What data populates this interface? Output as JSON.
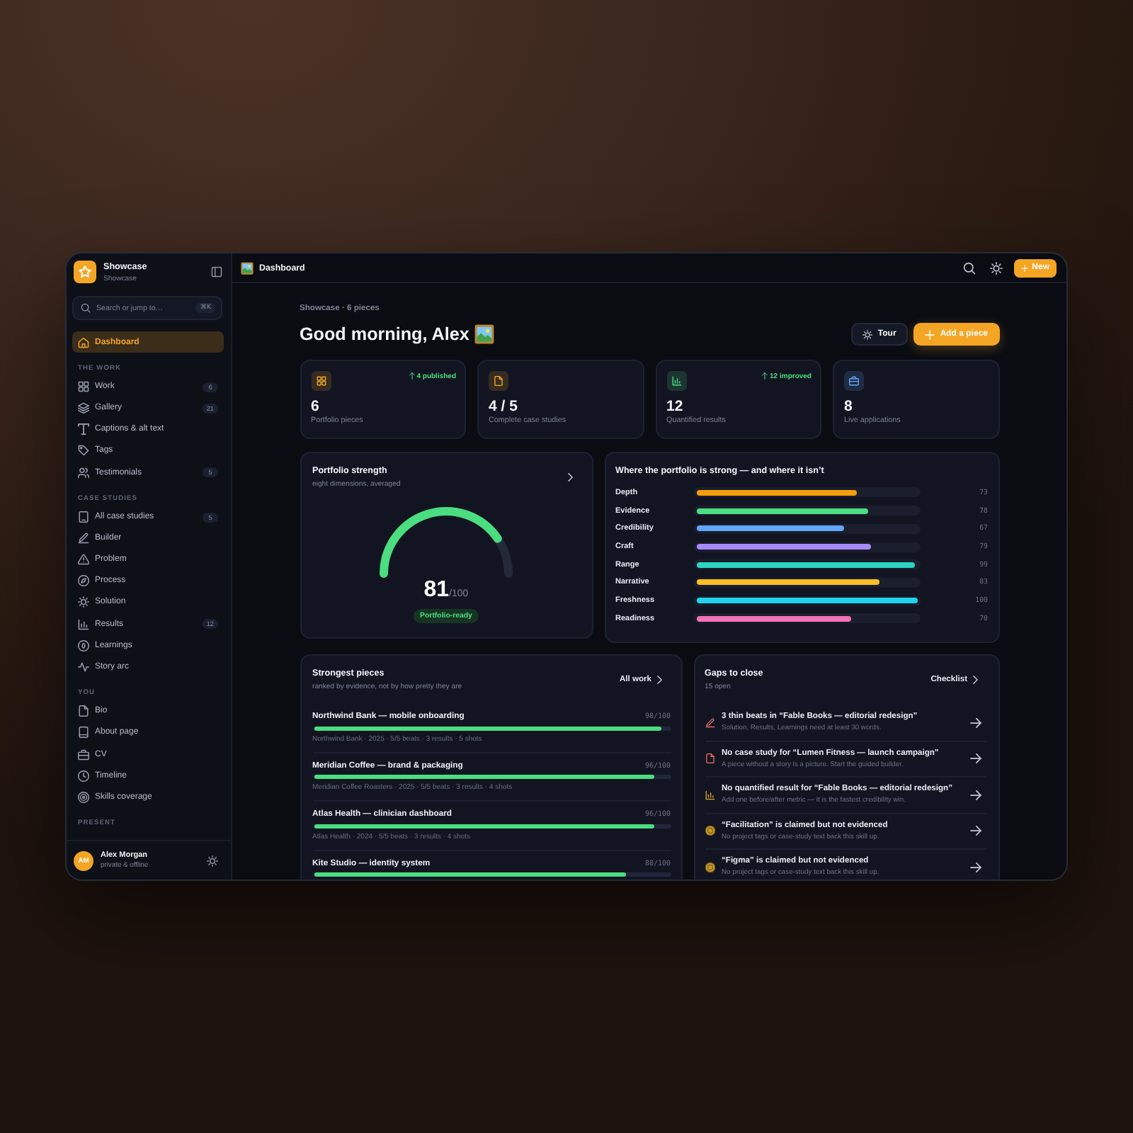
{
  "sidebar": {
    "brand": {
      "name": "Showcase",
      "subtitle": "Showcase"
    },
    "search": {
      "placeholder": "Search or jump to…",
      "shortcut": "⌘K"
    },
    "primary": [
      {
        "label": "Dashboard",
        "selected": true
      }
    ],
    "sections": [
      {
        "title": "THE WORK",
        "items": [
          {
            "label": "Work",
            "count": "6",
            "selected": false
          },
          {
            "label": "Gallery",
            "count": "21",
            "selected": false
          },
          {
            "label": "Captions & alt text",
            "selected": false
          },
          {
            "label": "Tags",
            "selected": false
          },
          {
            "label": "Testimonials",
            "count": "5",
            "selected": false
          }
        ]
      },
      {
        "title": "CASE STUDIES",
        "items": [
          {
            "label": "All case studies",
            "count": "5",
            "selected": false
          },
          {
            "label": "Builder",
            "selected": false
          },
          {
            "label": "Problem",
            "selected": false
          },
          {
            "label": "Process",
            "selected": false
          },
          {
            "label": "Solution",
            "selected": false
          },
          {
            "label": "Results",
            "count": "12",
            "selected": false
          },
          {
            "label": "Learnings",
            "selected": false
          },
          {
            "label": "Story arc",
            "selected": false
          }
        ]
      },
      {
        "title": "YOU",
        "items": [
          {
            "label": "Bio",
            "selected": false
          },
          {
            "label": "About page",
            "selected": false
          },
          {
            "label": "CV",
            "selected": false
          },
          {
            "label": "Timeline",
            "selected": false
          },
          {
            "label": "Skills coverage",
            "selected": false
          }
        ]
      },
      {
        "title": "PRESENT"
      }
    ],
    "user": {
      "initials": "AM",
      "name": "Alex Morgan",
      "status": "private & offline"
    }
  },
  "topbar": {
    "title": "Dashboard",
    "button": "New"
  },
  "header": {
    "eyebrow": "Showcase · 6 pieces",
    "greeting": "Good morning, Alex",
    "buttons": [
      {
        "label": "Tour",
        "kind": "secondary"
      },
      {
        "label": "Add a piece",
        "kind": "primary"
      }
    ]
  },
  "stats": [
    {
      "value": "6",
      "label": "Portfolio pieces",
      "trend": "4 published"
    },
    {
      "value": "4 / 5",
      "label": "Complete case studies"
    },
    {
      "value": "12",
      "label": "Quantified results",
      "trend": "12 improved"
    },
    {
      "value": "8",
      "label": "Live applications"
    }
  ],
  "strength": {
    "title": "Portfolio strength",
    "subtitle": "eight dimensions, averaged",
    "score": "81",
    "max": "/100",
    "level": 0.81,
    "status": "Portfolio-ready"
  },
  "dimensions": {
    "title": "Where the portfolio is strong — and where it isn’t",
    "items": [
      {
        "label": "Depth",
        "level": 0.73,
        "reading": "73",
        "color": "#f59e0b"
      },
      {
        "label": "Evidence",
        "level": 0.78,
        "reading": "78",
        "color": "#4ade80"
      },
      {
        "label": "Credibility",
        "level": 0.67,
        "reading": "67",
        "color": "#60a5fa"
      },
      {
        "label": "Craft",
        "level": 0.79,
        "reading": "79",
        "color": "#a78bfa"
      },
      {
        "label": "Range",
        "level": 0.99,
        "reading": "99",
        "color": "#2dd4bf"
      },
      {
        "label": "Narrative",
        "level": 0.83,
        "reading": "83",
        "color": "#fbbf24"
      },
      {
        "label": "Freshness",
        "level": 1,
        "reading": "100",
        "color": "#22d3ee"
      },
      {
        "label": "Readiness",
        "level": 0.7,
        "reading": "70",
        "color": "#f472b6"
      }
    ]
  },
  "pieces": {
    "title": "Strongest pieces",
    "subtitle": "ranked by evidence, not by how pretty they are",
    "link": "All work",
    "items": [
      {
        "title": "Northwind Bank — mobile onboarding",
        "score": "98/100",
        "level": 0.98,
        "meta": "Northwind Bank · 2025 · 5/5 beats · 3 results · 5 shots"
      },
      {
        "title": "Meridian Coffee — brand & packaging",
        "score": "96/100",
        "level": 0.96,
        "meta": "Meridian Coffee Roasters · 2025 · 5/5 beats · 3 results · 4 shots"
      },
      {
        "title": "Atlas Health — clinician dashboard",
        "score": "96/100",
        "level": 0.96,
        "meta": "Atlas Health · 2024 · 5/5 beats · 3 results · 4 shots"
      },
      {
        "title": "Kite Studio — identity system",
        "score": "88/100",
        "level": 0.88
      }
    ]
  },
  "gaps": {
    "title": "Gaps to close",
    "subtitle": "15 open",
    "link": "Checklist",
    "items": [
      {
        "kind": "thin_beats",
        "title": "3 thin beats in “Fable Books — editorial redesign”",
        "detail": "Solution, Results, Learnings need at least 30 words."
      },
      {
        "kind": "no_case_study",
        "title": "No case study for “Lumen Fitness — launch campaign”",
        "detail": "A piece without a story is a picture. Start the guided builder."
      },
      {
        "kind": "no_result",
        "title": "No quantified result for “Fable Books — editorial redesign”",
        "detail": "Add one before/after metric — it is the fastest credibility win."
      },
      {
        "kind": "unevidenced_skill",
        "title": "“Facilitation” is claimed but not evidenced",
        "detail": "No project tags or case-study text back this skill up."
      },
      {
        "kind": "unevidenced_skill",
        "title": "“Figma” is claimed but not evidenced",
        "detail": "No project tags or case-study text back this skill up."
      }
    ]
  }
}
